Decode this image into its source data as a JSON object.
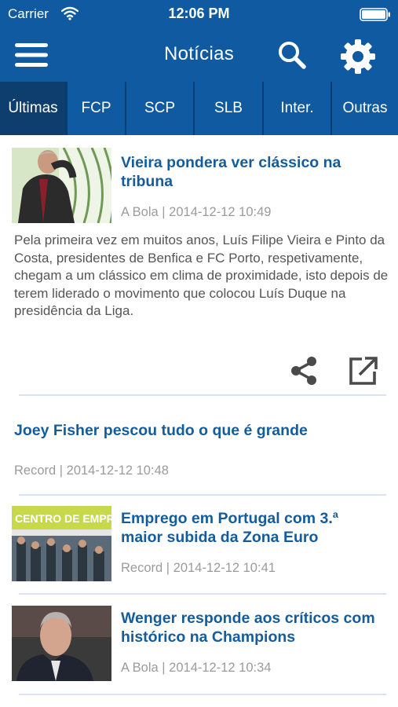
{
  "status_bar": {
    "carrier": "Carrier",
    "time": "12:06 PM"
  },
  "navbar": {
    "title": "Notícias"
  },
  "tabs": [
    {
      "label": "Últimas",
      "active": true
    },
    {
      "label": "FCP",
      "active": false
    },
    {
      "label": "SCP",
      "active": false
    },
    {
      "label": "SLB",
      "active": false
    },
    {
      "label": "Inter.",
      "active": false
    },
    {
      "label": "Outras",
      "active": false
    }
  ],
  "articles": [
    {
      "title_line1": "Vieira pondera ver clássico na",
      "title_line2": "tribuna",
      "meta": "A Bola | 2014-12-12 10:49",
      "summary": "Pela primeira vez em muitos anos, Luís Filipe Vieira e Pinto da Costa, presidentes de Benfica e FC Porto, respetivamente, chegam a um clássico em clima de proximidade, isto depois de terem liderado o movimento que colocou Luís Duque na presidência da Liga."
    },
    {
      "title_line1": "Joey Fisher pescou tudo o que é grande",
      "meta": "Record | 2014-12-12 10:48"
    },
    {
      "title_line1": "Emprego em Portugal com 3.ª",
      "title_line2": "maior subida da Zona Euro",
      "meta": "Record | 2014-12-12 10:41",
      "image_text": "CENTRO DE EMPREGO"
    },
    {
      "title_line1": "Wenger responde aos críticos com",
      "title_line2": "histórico na Champions",
      "meta": "A Bola | 2014-12-12 10:34"
    }
  ],
  "colors": {
    "header": "#0f5aa0",
    "tab_active": "#0d3e6e",
    "title": "#145c9c",
    "meta": "#9b9b9b",
    "divider": "#d6e5f1"
  },
  "icons": [
    "wifi-icon",
    "battery-icon",
    "menu-icon",
    "search-icon",
    "gear-icon",
    "share-icon",
    "open-external-icon"
  ]
}
